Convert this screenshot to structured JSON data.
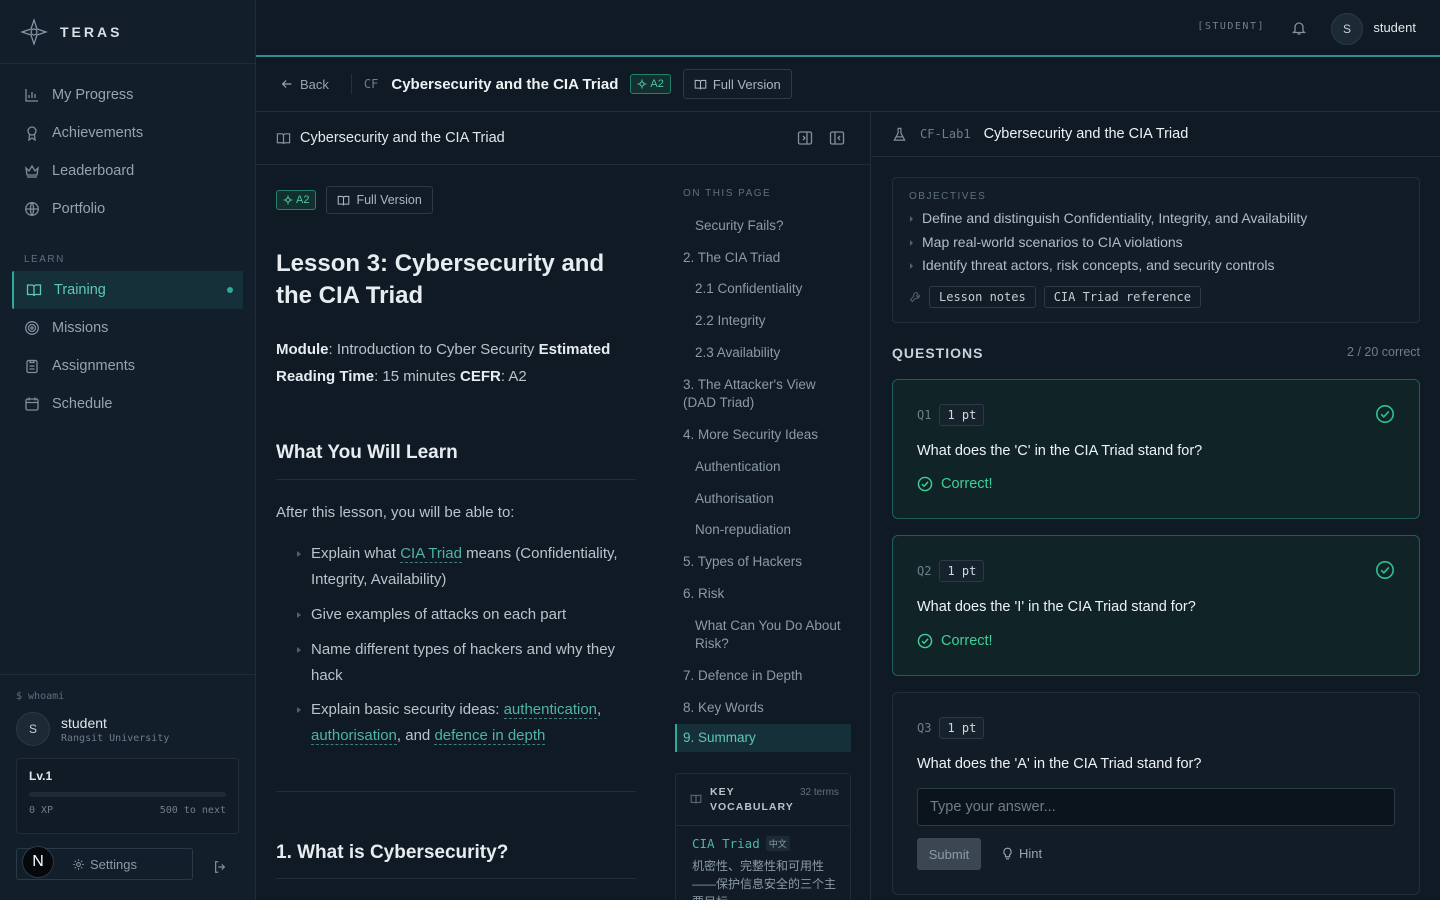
{
  "brand": {
    "name": "TERAS"
  },
  "sidebar": {
    "items": [
      {
        "label": "My Progress",
        "icon": "bar-chart-icon"
      },
      {
        "label": "Achievements",
        "icon": "award-icon"
      },
      {
        "label": "Leaderboard",
        "icon": "crown-icon"
      },
      {
        "label": "Portfolio",
        "icon": "globe-icon"
      }
    ],
    "section_label": "LEARN",
    "learn_items": [
      {
        "label": "Training",
        "icon": "book-open-icon",
        "active": true
      },
      {
        "label": "Missions",
        "icon": "target-icon"
      },
      {
        "label": "Assignments",
        "icon": "clipboard-icon"
      },
      {
        "label": "Schedule",
        "icon": "calendar-icon"
      }
    ]
  },
  "profile": {
    "whoami": "$ whoami",
    "avatar_initial": "S",
    "name": "student",
    "university": "Rangsit University",
    "level": "Lv.1",
    "xp": "0 XP",
    "next": "500 to next",
    "xp_progress": 0,
    "settings_label": "Settings",
    "n_badge": "N"
  },
  "topbar": {
    "role": "[STUDENT]",
    "avatar_initial": "S",
    "username": "student",
    "accent": "#2a8e98"
  },
  "lesson_header": {
    "back_label": "Back",
    "code": "CF",
    "title": "Cybersecurity and the CIA Triad",
    "level_badge": "A2",
    "full_version_label": "Full Version"
  },
  "content": {
    "panel_title": "Cybersecurity and the CIA Triad",
    "badge": "A2",
    "full_version_label": "Full Version",
    "heading": "Lesson 3: Cybersecurity and the CIA Triad",
    "meta": {
      "module_label": "Module",
      "module_value": ": Introduction to Cyber Security ",
      "time_label": "Estimated Reading Time",
      "time_value": ": 15 minutes ",
      "cefr_label": "CEFR",
      "cefr_value": ": A2"
    },
    "learn_heading": "What You Will Learn",
    "intro": "After this lesson, you will be able to:",
    "bullet1_pre": "Explain what ",
    "bullet1_link": "CIA Triad",
    "bullet1_post": " means (Confidentiality, Integrity, Availability)",
    "bullet2": "Give examples of attacks on each part",
    "bullet3": "Name different types of hackers and why they hack",
    "bullet4_pre": "Explain basic security ideas: ",
    "bullet4_link1": "authentication",
    "bullet4_comma": ", ",
    "bullet4_link2": "authorisation",
    "bullet4_and": ", and ",
    "bullet4_link3": "defence in depth",
    "section1": "1. What is Cybersecurity?"
  },
  "toc": {
    "title": "ON THIS PAGE",
    "items": [
      "Security Fails?",
      "2. The CIA Triad",
      "2.1 Confidentiality",
      "2.2 Integrity",
      "2.3 Availability",
      "3. The Attacker's View (DAD Triad)",
      "4. More Security Ideas",
      "Authentication",
      "Authorisation",
      "Non-repudiation",
      "5. Types of Hackers",
      "6. Risk",
      "What Can You Do About Risk?",
      "7. Defence in Depth",
      "8. Key Words",
      "9. Summary"
    ]
  },
  "vocab": {
    "title": "KEY VOCABULARY",
    "count": "32 terms",
    "term": "CIA Triad",
    "tag": "中文",
    "definition": "机密性、完整性和可用性——保护信息安全的三个主要目标"
  },
  "lab": {
    "code": "CF-Lab1",
    "title": "Cybersecurity and the CIA Triad",
    "objectives_title": "OBJECTIVES",
    "objectives": [
      "Define and distinguish Confidentiality, Integrity, and Availability",
      "Map real-world scenarios to CIA violations",
      "Identify threat actors, risk concepts, and security controls"
    ],
    "resources": [
      "Lesson notes",
      "CIA Triad reference"
    ],
    "questions_title": "QUESTIONS",
    "questions_count": "2 / 20 correct",
    "questions": [
      {
        "num": "Q1",
        "points": "1 pt",
        "text": "What does the 'C' in the CIA Triad stand for?",
        "result": "Correct!"
      },
      {
        "num": "Q2",
        "points": "1 pt",
        "text": "What does the 'I' in the CIA Triad stand for?",
        "result": "Correct!"
      },
      {
        "num": "Q3",
        "points": "1 pt",
        "text": "What does the 'A' in the CIA Triad stand for?",
        "placeholder": "Type your answer...",
        "submit": "Submit",
        "hint": "Hint"
      }
    ]
  }
}
